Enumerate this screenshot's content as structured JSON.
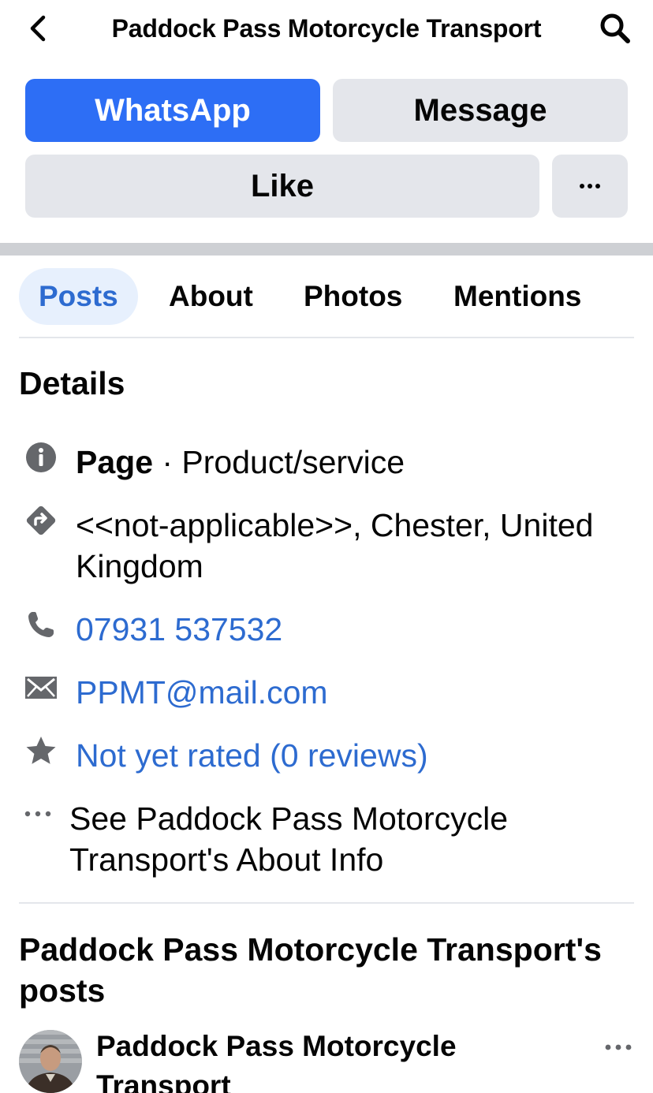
{
  "header": {
    "title": "Paddock Pass Motorcycle Transport",
    "back_icon": "chevron-left-icon",
    "search_icon": "search-icon"
  },
  "actions": {
    "whatsapp_label": "WhatsApp",
    "message_label": "Message",
    "like_label": "Like",
    "more_label": "···"
  },
  "tabs": [
    {
      "label": "Posts",
      "active": true
    },
    {
      "label": "About",
      "active": false
    },
    {
      "label": "Photos",
      "active": false
    },
    {
      "label": "Mentions",
      "active": false
    }
  ],
  "details": {
    "heading": "Details",
    "page_label": "Page",
    "page_category": " · Product/service",
    "address_line1": "<<not-applicable>>, Chester, United",
    "address_line2": "Kingdom",
    "phone": "07931 537532",
    "email": "PPMT@mail.com",
    "rating": "Not yet rated (0 reviews)",
    "about_line1": "See Paddock Pass Motorcycle",
    "about_line2": "Transport's About Info"
  },
  "posts": {
    "heading_line1": "Paddock Pass Motorcycle Transport's",
    "heading_line2": "posts",
    "author_line1": "Paddock Pass Motorcycle",
    "author_line2": "Transport"
  },
  "colors": {
    "accent": "#2d6ef5",
    "link": "#2d6bd0",
    "button_grey": "#e4e6eb",
    "icon_grey": "#65676b"
  }
}
